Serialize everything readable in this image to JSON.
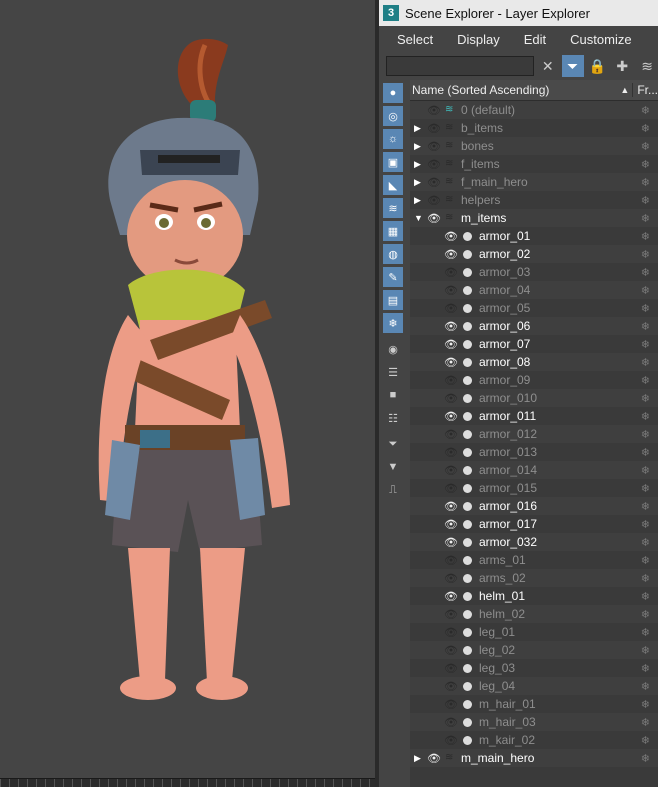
{
  "window": {
    "title": "Scene Explorer - Layer Explorer",
    "app_icon": "3"
  },
  "menu": [
    "Select",
    "Display",
    "Edit",
    "Customize"
  ],
  "header": {
    "name_col": "Name (Sorted Ascending)",
    "freeze_col": "Fr..."
  },
  "top_layers": [
    {
      "name": "0 (default)",
      "expander": false,
      "visible": false,
      "active": true
    },
    {
      "name": "b_items",
      "expander": true,
      "visible": false
    },
    {
      "name": "bones",
      "expander": true,
      "visible": false
    },
    {
      "name": "f_items",
      "expander": true,
      "visible": false
    },
    {
      "name": "f_main_hero",
      "expander": true,
      "visible": false
    },
    {
      "name": "helpers",
      "expander": true,
      "visible": false
    },
    {
      "name": "m_items",
      "expander": true,
      "expanded": true,
      "visible": true
    }
  ],
  "m_items_children": [
    {
      "name": "armor_01",
      "visible": true
    },
    {
      "name": "armor_02",
      "visible": true
    },
    {
      "name": "armor_03",
      "visible": false
    },
    {
      "name": "armor_04",
      "visible": false
    },
    {
      "name": "armor_05",
      "visible": false
    },
    {
      "name": "armor_06",
      "visible": true
    },
    {
      "name": "armor_07",
      "visible": true
    },
    {
      "name": "armor_08",
      "visible": true
    },
    {
      "name": "armor_09",
      "visible": false
    },
    {
      "name": "armor_010",
      "visible": false
    },
    {
      "name": "armor_011",
      "visible": true
    },
    {
      "name": "armor_012",
      "visible": false
    },
    {
      "name": "armor_013",
      "visible": false
    },
    {
      "name": "armor_014",
      "visible": false
    },
    {
      "name": "armor_015",
      "visible": false
    },
    {
      "name": "armor_016",
      "visible": true
    },
    {
      "name": "armor_017",
      "visible": true
    },
    {
      "name": "armor_032",
      "visible": true
    },
    {
      "name": "arms_01",
      "visible": false
    },
    {
      "name": "arms_02",
      "visible": false
    },
    {
      "name": "helm_01",
      "visible": true
    },
    {
      "name": "helm_02",
      "visible": false
    },
    {
      "name": "leg_01",
      "visible": false
    },
    {
      "name": "leg_02",
      "visible": false
    },
    {
      "name": "leg_03",
      "visible": false
    },
    {
      "name": "leg_04",
      "visible": false
    },
    {
      "name": "m_hair_01",
      "visible": false
    },
    {
      "name": "m_hair_03",
      "visible": false
    },
    {
      "name": "m_kair_02",
      "visible": false
    }
  ],
  "bottom_layers": [
    {
      "name": "m_main_hero",
      "expander": true,
      "visible": true
    }
  ],
  "sidebar_icons": [
    "geometry-icon",
    "shapes-icon",
    "lights-icon",
    "cameras-icon",
    "helpers-icon",
    "spacewarps-icon",
    "groups-icon",
    "xrefs-icon",
    "bones-icon",
    "containers-icon",
    "frozen-icon",
    "hidden-icon",
    "display-all-icon",
    "display-none-icon",
    "invert-icon",
    "filter-icon",
    "filter-alt-icon",
    "sync-icon"
  ],
  "colors": {
    "accent": "#5a87b4",
    "layer_active": "#40c0c0"
  }
}
